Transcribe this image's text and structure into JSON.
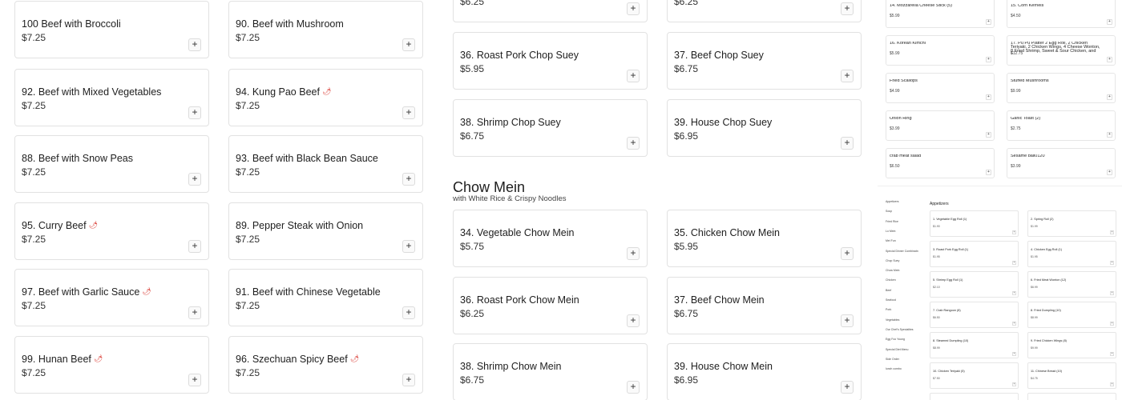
{
  "menu": {
    "col1": [
      {
        "name": "100 Beef with Broccoli",
        "price": "$7.25",
        "spicy": false
      },
      {
        "name": "92. Beef with Mixed Vegetables",
        "price": "$7.25",
        "spicy": false
      },
      {
        "name": "88. Beef with Snow Peas",
        "price": "$7.25",
        "spicy": false
      },
      {
        "name": "95. Curry Beef",
        "price": "$7.25",
        "spicy": true
      },
      {
        "name": "97. Beef with Garlic Sauce",
        "price": "$7.25",
        "spicy": true
      },
      {
        "name": "99. Hunan Beef",
        "price": "$7.25",
        "spicy": true
      }
    ],
    "col2": [
      {
        "name": "90. Beef with Mushroom",
        "price": "$7.25",
        "spicy": false
      },
      {
        "name": "94. Kung Pao Beef",
        "price": "$7.25",
        "spicy": true
      },
      {
        "name": "93. Beef with Black Bean Sauce",
        "price": "$7.25",
        "spicy": false
      },
      {
        "name": "89. Pepper Steak with Onion",
        "price": "$7.25",
        "spicy": false
      },
      {
        "name": "91. Beef with Chinese Vegetable",
        "price": "$7.25",
        "spicy": false
      },
      {
        "name": "96. Szechuan Spicy Beef",
        "price": "$7.25",
        "spicy": true
      }
    ],
    "chop_suey_col3": [
      {
        "name": "",
        "price": "$6.25"
      },
      {
        "name": "36. Roast Pork Chop Suey",
        "price": "$5.95"
      },
      {
        "name": "38. Shrimp Chop Suey",
        "price": "$6.75"
      }
    ],
    "chop_suey_col4": [
      {
        "name": "",
        "price": "$6.25"
      },
      {
        "name": "37. Beef Chop Suey",
        "price": "$6.75"
      },
      {
        "name": "39. House Chop Suey",
        "price": "$6.95"
      }
    ],
    "chow_mein": {
      "title": "Chow Mein",
      "subtitle": "with White Rice & Crispy Noodles",
      "col3": [
        {
          "name": "34. Vegetable Chow Mein",
          "price": "$5.75"
        },
        {
          "name": "36. Roast Pork Chow Mein",
          "price": "$6.25"
        },
        {
          "name": "38. Shrimp Chow Mein",
          "price": "$6.75"
        }
      ],
      "col4": [
        {
          "name": "35. Chicken Chow Mein",
          "price": "$5.95"
        },
        {
          "name": "37. Beef Chow Mein",
          "price": "$6.75"
        },
        {
          "name": "39. House Chow Mein",
          "price": "$6.95"
        }
      ]
    },
    "add_symbol": "+",
    "chili_symbol": "🌶"
  },
  "side_mini": {
    "left": [
      {
        "name": "14. Mozzarella Cheese Stick (5)",
        "price": "$5.99"
      },
      {
        "name": "16. Korean Kimchi",
        "price": "$5.99"
      },
      {
        "name": "Fried Scallops",
        "price": "$4.99"
      },
      {
        "name": "Onion Ring",
        "price": "$3.99"
      },
      {
        "name": "crab meat salad",
        "price": "$6.50"
      }
    ],
    "right": [
      {
        "name": "15. Corn Kernels",
        "price": "$4.50"
      },
      {
        "name": "17. Pu Pu Platter 2 Egg Roll, 2 Chicken Teriyaki, 2 Chicken Wings, 4 Cheese Wonton, 8 Fried Shrimp, Sweet & Sour Chicken, and 2...",
        "price": "$12.75"
      },
      {
        "name": "Stuffed Mushrooms",
        "price": "$9.99"
      },
      {
        "name": "Garlic Toast (2)",
        "price": "$2.75"
      },
      {
        "name": "Sesame ball0120",
        "price": "$3.99"
      }
    ]
  },
  "thumbnail": {
    "nav": [
      "Appetizers",
      "Soup",
      "Fried Rice",
      "Lo Mein",
      "Mei Fun",
      "Special Dinner Combinatn",
      "Chop Suey",
      "Chow Mein",
      "Chicken",
      "Beef",
      "Seafood",
      "Pork",
      "Vegetables",
      "Our Chef's Specialties",
      "Egg Foo Young",
      "Special Diet Menu",
      "Side Order",
      "lunch combo"
    ],
    "heading": "Appetizers",
    "left": [
      {
        "name": "1. Vegetable Egg Roll (1)",
        "price": "$1.90"
      },
      {
        "name": "3. Roast Pork Egg Roll (1)",
        "price": "$1.95"
      },
      {
        "name": "5. Shrimp Egg Roll (1)",
        "price": "$2.10"
      },
      {
        "name": "7. Crab Rangoon (8)",
        "price": "$6.50"
      },
      {
        "name": "8. Steamed Dumpling (10)",
        "price": "$8.99"
      },
      {
        "name": "10. Chicken Teriyaki (5)",
        "price": "$7.50"
      }
    ],
    "right": [
      {
        "name": "2. Spring Roll (2)",
        "price": "$1.99"
      },
      {
        "name": "4. Chicken Egg Roll (1)",
        "price": "$1.95"
      },
      {
        "name": "6. Fried Meat Wonton (12)",
        "price": "$6.99"
      },
      {
        "name": "8. Fried Dumpling (10)",
        "price": "$8.99"
      },
      {
        "name": "9. Fried Chicken Wings (8)",
        "price": "$9.99"
      },
      {
        "name": "11. Chinese Bread (10)",
        "price": "$4.75"
      }
    ]
  }
}
